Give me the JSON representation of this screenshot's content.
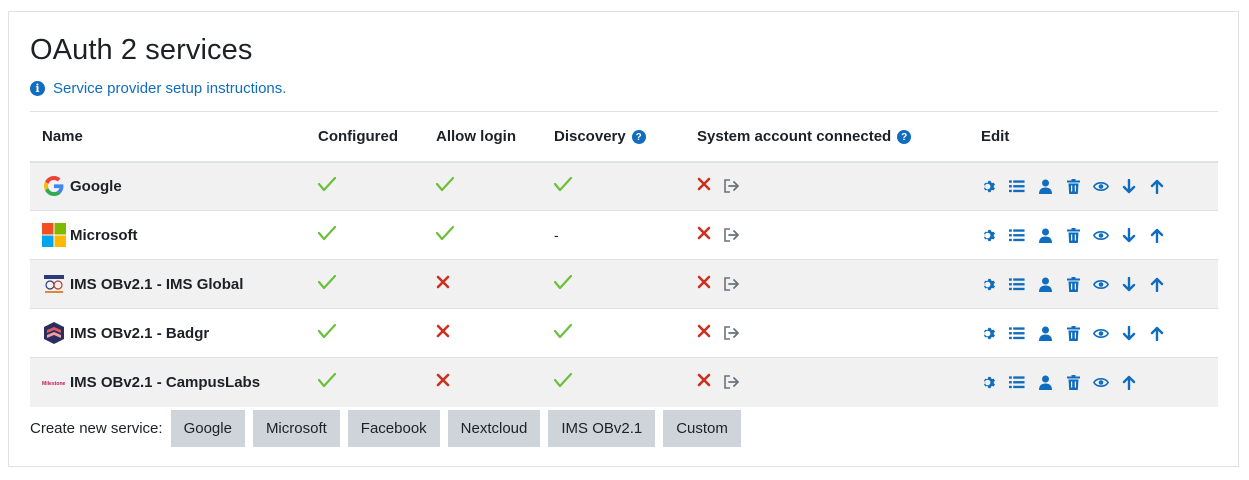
{
  "page_title": "OAuth 2 services",
  "help_link": "Service provider setup instructions.",
  "columns": {
    "name": "Name",
    "configured": "Configured",
    "allow_login": "Allow login",
    "discovery": "Discovery",
    "system_account": "System account connected",
    "edit": "Edit"
  },
  "services": [
    {
      "name": "Google",
      "logo": "google-logo",
      "configured": "check",
      "allow_login": "check",
      "discovery": "check",
      "has_down": true,
      "has_up": true
    },
    {
      "name": "Microsoft",
      "logo": "microsoft-logo",
      "configured": "check",
      "allow_login": "check",
      "discovery": "-",
      "has_down": true,
      "has_up": true
    },
    {
      "name": "IMS OBv2.1 - IMS Global",
      "logo": "ims-global-logo",
      "configured": "check",
      "allow_login": "cross",
      "discovery": "check",
      "has_down": true,
      "has_up": true
    },
    {
      "name": "IMS OBv2.1 - Badgr",
      "logo": "badgr-logo",
      "configured": "check",
      "allow_login": "cross",
      "discovery": "check",
      "has_down": true,
      "has_up": true
    },
    {
      "name": "IMS OBv2.1 - CampusLabs",
      "logo": "milestone-logo",
      "logo_text": "Milestone",
      "configured": "check",
      "allow_login": "cross",
      "discovery": "check",
      "has_down": false,
      "has_up": true
    }
  ],
  "create_label": "Create new service:",
  "create_buttons": [
    "Google",
    "Microsoft",
    "Facebook",
    "Nextcloud",
    "IMS OBv2.1",
    "Custom"
  ],
  "colors": {
    "link": "#0f6cbf",
    "check": "#6cbf3a",
    "cross": "#ca3120",
    "button_bg": "#ced4da",
    "row_stripe": "#f1f1f1"
  }
}
